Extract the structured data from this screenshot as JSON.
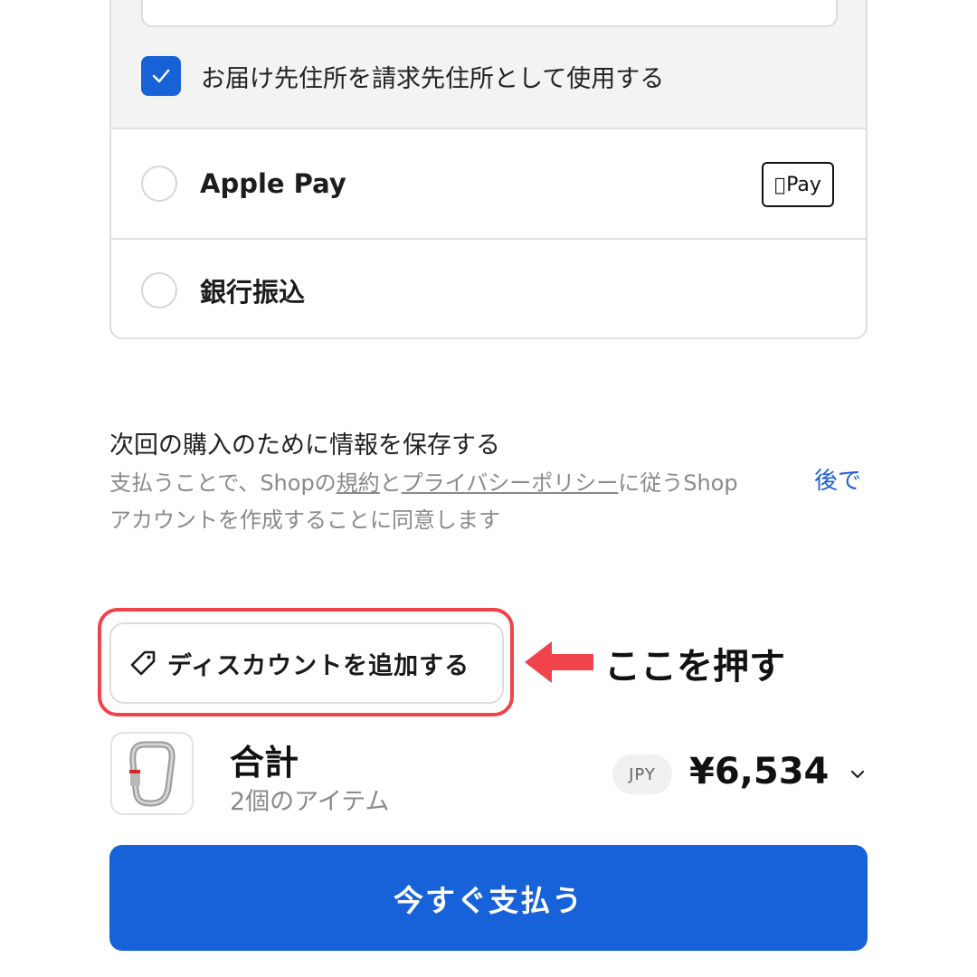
{
  "billing": {
    "same_address_label": "お届け先住所を請求先住所として使用する",
    "checked": true
  },
  "payment_options": {
    "apple_pay": {
      "label": "Apple Pay",
      "badge_text": "Pay"
    },
    "bank_transfer": {
      "label": "銀行振込"
    }
  },
  "save_info": {
    "title": "次回の購入のために情報を保存する",
    "desc_part1": "支払うことで、Shopの",
    "terms_link": "規約",
    "desc_part2": "と",
    "privacy_link": "プライバシーポリシー",
    "desc_part3": "に従うShop",
    "desc_line2": "アカウントを作成することに同意します",
    "later_link": "後で"
  },
  "discount": {
    "button_label": "ディスカウントを追加する",
    "annotation": "ここを押す"
  },
  "summary": {
    "title": "合計",
    "subtitle": "2個のアイテム",
    "currency": "JPY",
    "amount": "¥6,534"
  },
  "pay_button": {
    "label": "今すぐ支払う"
  },
  "colors": {
    "accent": "#1762d8",
    "highlight": "#f0434b"
  }
}
